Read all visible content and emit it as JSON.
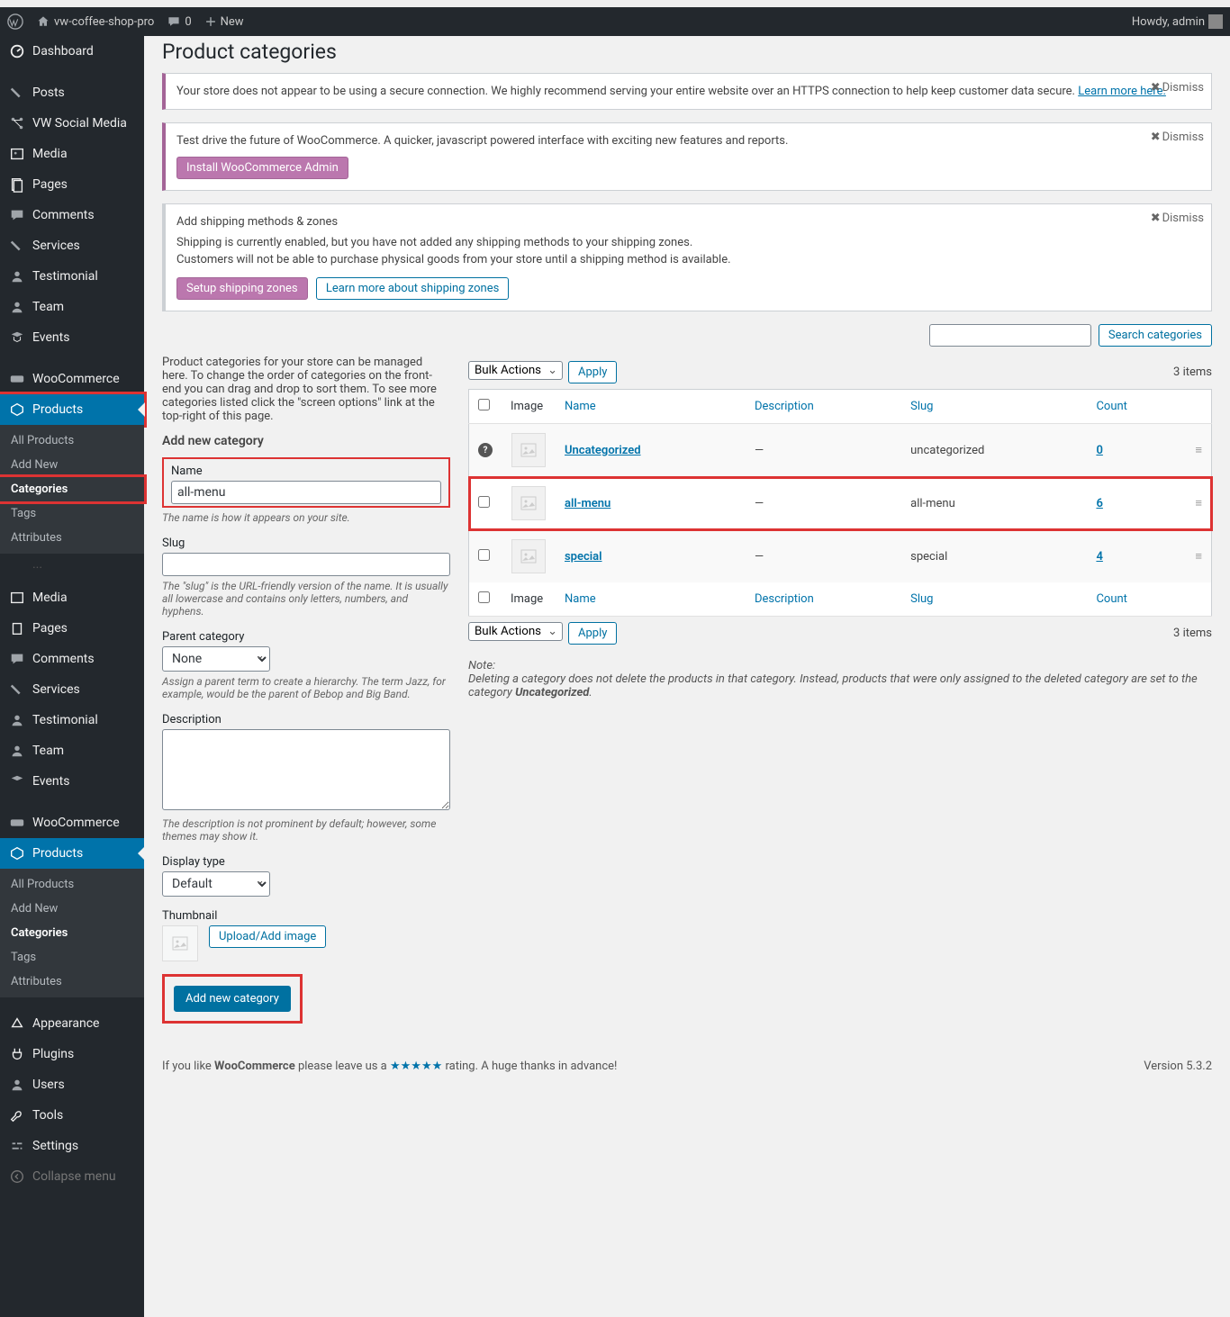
{
  "adminbar": {
    "site": "vw-coffee-shop-pro",
    "comments": "0",
    "new": "New",
    "howdy": "Howdy, admin"
  },
  "sidebar": {
    "dashboard": "Dashboard",
    "posts": "Posts",
    "vw_social": "VW Social Media",
    "media": "Media",
    "pages": "Pages",
    "comments": "Comments",
    "services": "Services",
    "testimonial": "Testimonial",
    "team": "Team",
    "events": "Events",
    "woocommerce": "WooCommerce",
    "products": "Products",
    "appearance": "Appearance",
    "plugins": "Plugins",
    "users": "Users",
    "tools": "Tools",
    "settings": "Settings",
    "collapse": "Collapse menu",
    "sub": {
      "all_products": "All Products",
      "add_new": "Add New",
      "categories": "Categories",
      "tags": "Tags",
      "attributes": "Attributes"
    }
  },
  "page": {
    "title": "Product categories",
    "intro": "Product categories for your store can be managed here. To change the order of categories on the front-end you can drag and drop to sort them. To see more categories listed click the \"screen options\" link at the top-right of this page.",
    "add_heading": "Add new category"
  },
  "notice1": {
    "text": "Your store does not appear to be using a secure connection. We highly recommend serving your entire website over an HTTPS connection to help keep customer data secure.",
    "link": "Learn more here.",
    "dismiss": "Dismiss"
  },
  "notice2": {
    "text": "Test drive the future of WooCommerce. A quicker, javascript powered interface with exciting new features and reports.",
    "button": "Install WooCommerce Admin",
    "dismiss": "Dismiss"
  },
  "notice3": {
    "title": "Add shipping methods & zones",
    "line1": "Shipping is currently enabled, but you have not added any shipping methods to your shipping zones.",
    "line2": "Customers will not be able to purchase physical goods from your store until a shipping method is available.",
    "btn1": "Setup shipping zones",
    "btn2": "Learn more about shipping zones",
    "dismiss": "Dismiss"
  },
  "form": {
    "name_label": "Name",
    "name_value": "all-menu",
    "name_help": "The name is how it appears on your site.",
    "slug_label": "Slug",
    "slug_help": "The \"slug\" is the URL-friendly version of the name. It is usually all lowercase and contains only letters, numbers, and hyphens.",
    "parent_label": "Parent category",
    "parent_value": "None",
    "parent_help": "Assign a parent term to create a hierarchy. The term Jazz, for example, would be the parent of Bebop and Big Band.",
    "desc_label": "Description",
    "desc_help": "The description is not prominent by default; however, some themes may show it.",
    "display_label": "Display type",
    "display_value": "Default",
    "thumb_label": "Thumbnail",
    "upload_btn": "Upload/Add image",
    "submit": "Add new category"
  },
  "table": {
    "search_btn": "Search categories",
    "bulk": "Bulk Actions",
    "apply": "Apply",
    "items_count": "3 items",
    "cols": {
      "image": "Image",
      "name": "Name",
      "description": "Description",
      "slug": "Slug",
      "count": "Count"
    },
    "rows": [
      {
        "name": "Uncategorized",
        "desc": "—",
        "slug": "uncategorized",
        "count": "0",
        "q": true
      },
      {
        "name": "all-menu",
        "desc": "—",
        "slug": "all-menu",
        "count": "6",
        "hl": true
      },
      {
        "name": "special",
        "desc": "—",
        "slug": "special",
        "count": "4"
      }
    ],
    "note_title": "Note:",
    "note_body_a": "Deleting a category does not delete the products in that category. Instead, products that were only assigned to the deleted category are set to the category ",
    "note_body_b": "Uncategorized",
    "note_body_c": "."
  },
  "footer": {
    "pre": "If you like ",
    "wc": "WooCommerce",
    "mid": " please leave us a ",
    "stars": "★★★★★",
    "post": " rating. A huge thanks in advance!",
    "version": "Version 5.3.2"
  }
}
